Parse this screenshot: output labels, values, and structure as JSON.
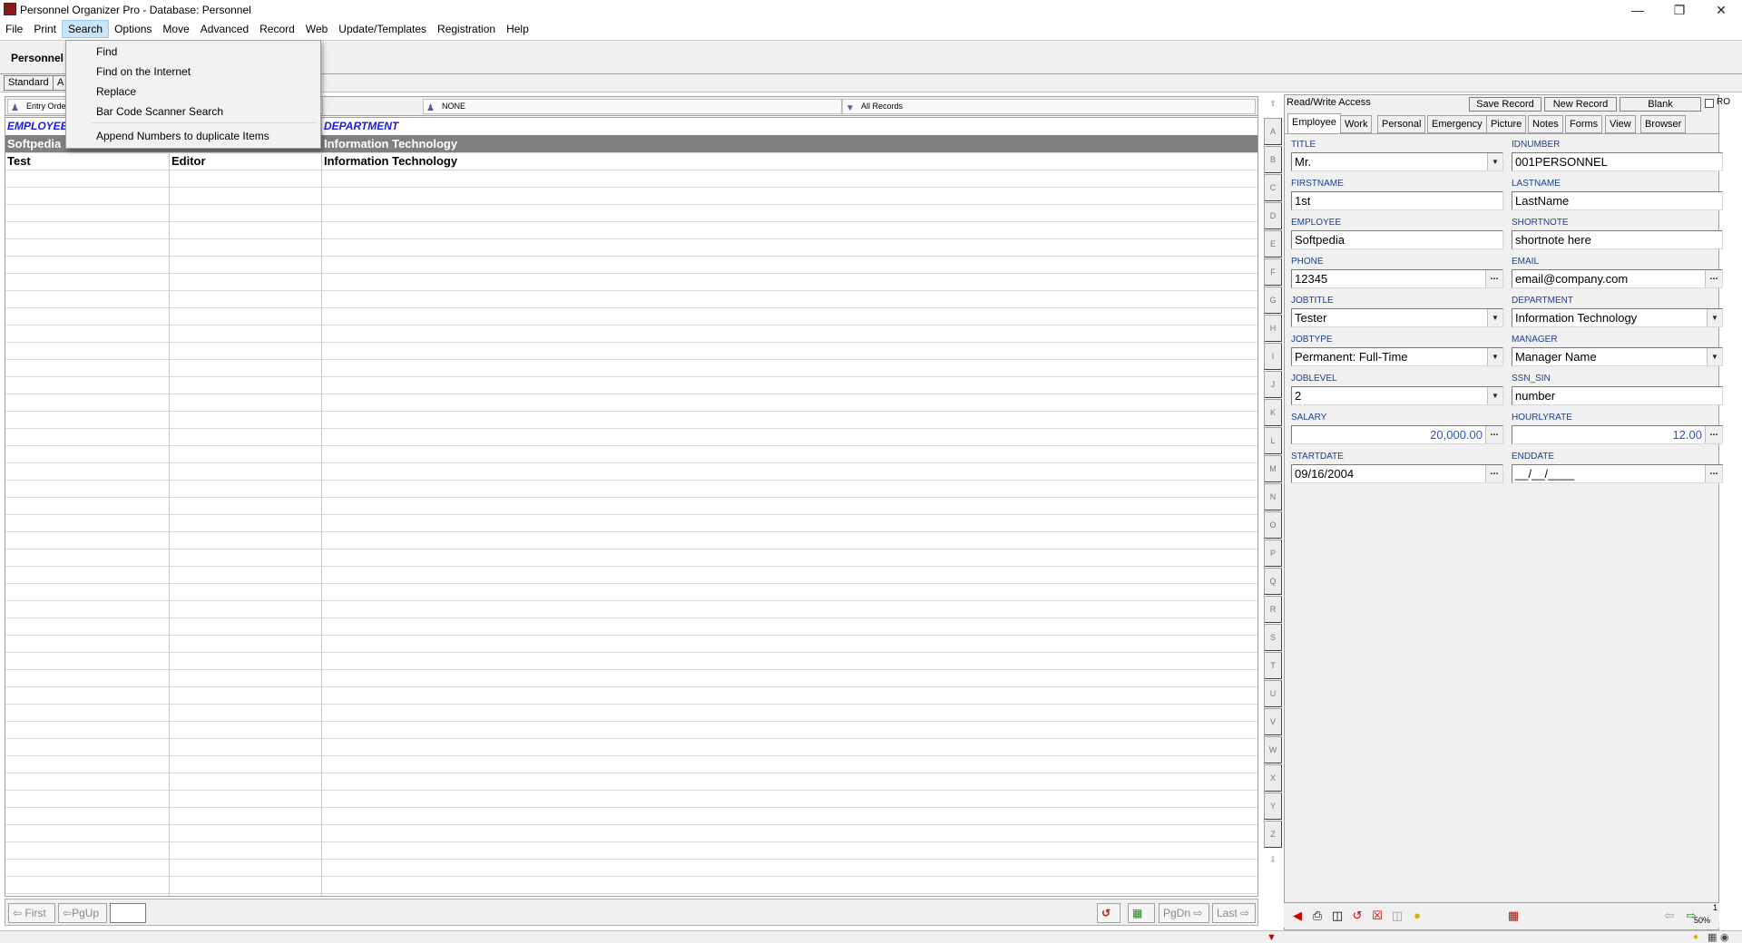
{
  "window": {
    "title": "Personnel Organizer Pro - Database: Personnel"
  },
  "menubar": {
    "items": [
      "File",
      "Print",
      "Search",
      "Options",
      "Move",
      "Advanced",
      "Record",
      "Web",
      "Update/Templates",
      "Registration",
      "Help"
    ]
  },
  "search_menu": {
    "items": [
      "Find",
      "Find on the Internet",
      "Replace",
      "Bar Code Scanner Search",
      "Append Numbers to duplicate Items"
    ]
  },
  "toolbar": {
    "db_label": "Personnel",
    "view_tabs": [
      "Standard",
      "A"
    ]
  },
  "grid_header": {
    "sort": "Entry Order",
    "filter": "NONE",
    "records": "All Records"
  },
  "grid": {
    "columns": [
      "EMPLOYEE",
      "",
      "DEPARTMENT"
    ],
    "rows": [
      [
        "Softpedia",
        "",
        "Information Technology"
      ],
      [
        "Test",
        "Editor",
        "Information Technology"
      ]
    ]
  },
  "alphabet": [
    "A",
    "B",
    "C",
    "D",
    "E",
    "F",
    "G",
    "H",
    "I",
    "J",
    "K",
    "L",
    "M",
    "N",
    "O",
    "P",
    "Q",
    "R",
    "S",
    "T",
    "U",
    "V",
    "W",
    "X",
    "Y",
    "Z"
  ],
  "nav": {
    "first": "First",
    "pgup": "PgUp",
    "pgdn": "PgDn",
    "last": "Last"
  },
  "record_panel": {
    "access": "Read/Write Access",
    "save": "Save Record",
    "new": "New Record",
    "blank": "Blank",
    "ro": "RO",
    "tabs": [
      "Employee",
      "Work",
      "Personal",
      "Emergency",
      "Picture",
      "Notes",
      "Forms",
      "View",
      "Browser"
    ],
    "fields": {
      "title_label": "TITLE",
      "title": "Mr.",
      "idnumber_label": "IDNUMBER",
      "idnumber": "001PERSONNEL",
      "firstname_label": "FIRSTNAME",
      "firstname": "1st",
      "lastname_label": "LASTNAME",
      "lastname": "LastName",
      "employee_label": "EMPLOYEE",
      "employee": "Softpedia",
      "shortnote_label": "SHORTNOTE",
      "shortnote": "shortnote here",
      "phone_label": "PHONE",
      "phone": "12345",
      "email_label": "EMAIL",
      "email": "email@company.com",
      "jobtitle_label": "JOBTITLE",
      "jobtitle": "Tester",
      "department_label": "DEPARTMENT",
      "department": "Information Technology",
      "jobtype_label": "JOBTYPE",
      "jobtype": "Permanent: Full-Time",
      "manager_label": "MANAGER",
      "manager": "Manager Name",
      "joblevel_label": "JOBLEVEL",
      "joblevel": "2",
      "ssn_label": "SSN_SIN",
      "ssn": "number",
      "salary_label": "SALARY",
      "salary": "20,000.00",
      "hourlyrate_label": "HOURLYRATE",
      "hourlyrate": "12.00",
      "startdate_label": "STARTDATE",
      "startdate": "09/16/2004",
      "enddate_label": "ENDDATE",
      "enddate": "__/__/____"
    }
  },
  "statusbar": {
    "counter": "1",
    "zoom": "50%"
  },
  "colors": {
    "menu_highlight": "#cce4f7",
    "column_header": "#1a1ae0",
    "selected_row": "#808080",
    "field_label": "#1b3f8f",
    "numeric_value": "#2a55cc"
  }
}
